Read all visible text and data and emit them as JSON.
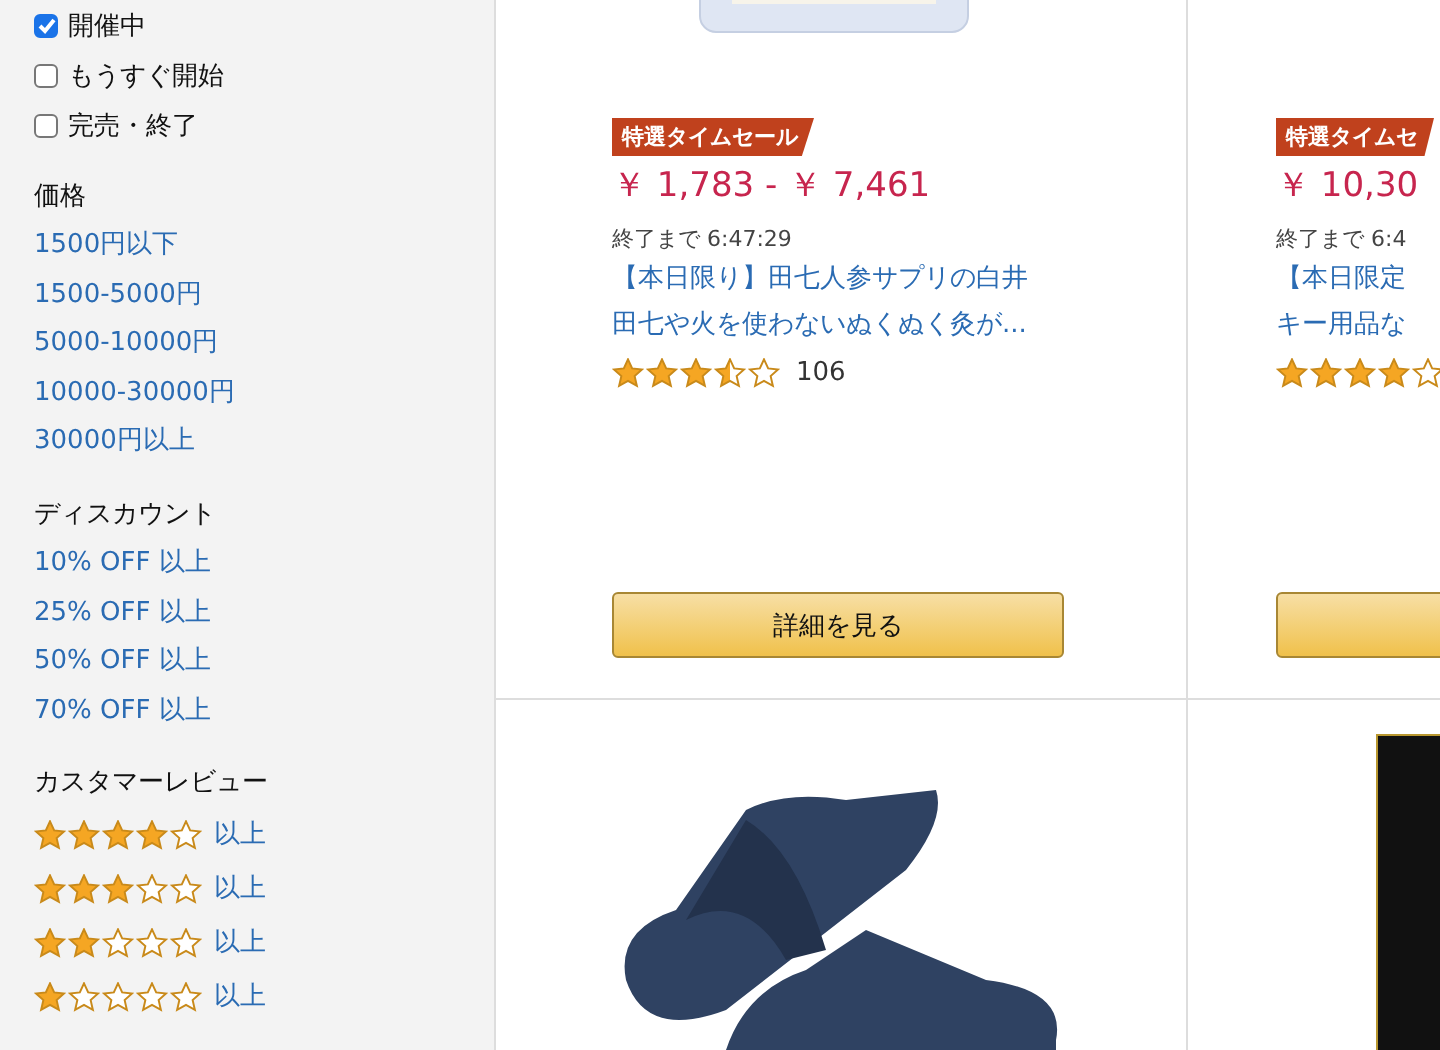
{
  "status_filters": [
    {
      "label": "開催中",
      "checked": true
    },
    {
      "label": "もうすぐ開始",
      "checked": false
    },
    {
      "label": "完売・終了",
      "checked": false
    }
  ],
  "link_sections": [
    {
      "title": "価格",
      "links": [
        "1500円以下",
        "1500-5000円",
        "5000-10000円",
        "10000-30000円",
        "30000円以上"
      ]
    },
    {
      "title": "ディスカウント",
      "links": [
        "10% OFF 以上",
        "25% OFF 以上",
        "50% OFF 以上",
        "70% OFF 以上"
      ]
    }
  ],
  "review_filter": {
    "title": "カスタマーレビュー",
    "rows": [
      {
        "stars": 4,
        "label": "以上"
      },
      {
        "stars": 3,
        "label": "以上"
      },
      {
        "stars": 2,
        "label": "以上"
      },
      {
        "stars": 1,
        "label": "以上"
      }
    ]
  },
  "products": [
    {
      "kind": "deal",
      "photo_visible": true,
      "badge": "特選タイムセール",
      "price": "￥ 1,783 - ￥ 7,461",
      "timer": "終了まで 6:47:29",
      "title_lines": [
        "【本日限り】田七人参サプリの白井",
        "田七や火を使わないぬくぬく灸が..."
      ],
      "stars": 3.5,
      "count": "106",
      "button": "詳細を見る"
    },
    {
      "kind": "deal",
      "photo_visible": false,
      "badge": "特選タイムセ",
      "price": "￥ 10,30",
      "timer": "終了まで 6:4",
      "title_lines": [
        "【本日限定",
        "キー用品な"
      ],
      "stars": 4
    },
    {
      "kind": "sandals"
    },
    {
      "kind": "box"
    }
  ]
}
